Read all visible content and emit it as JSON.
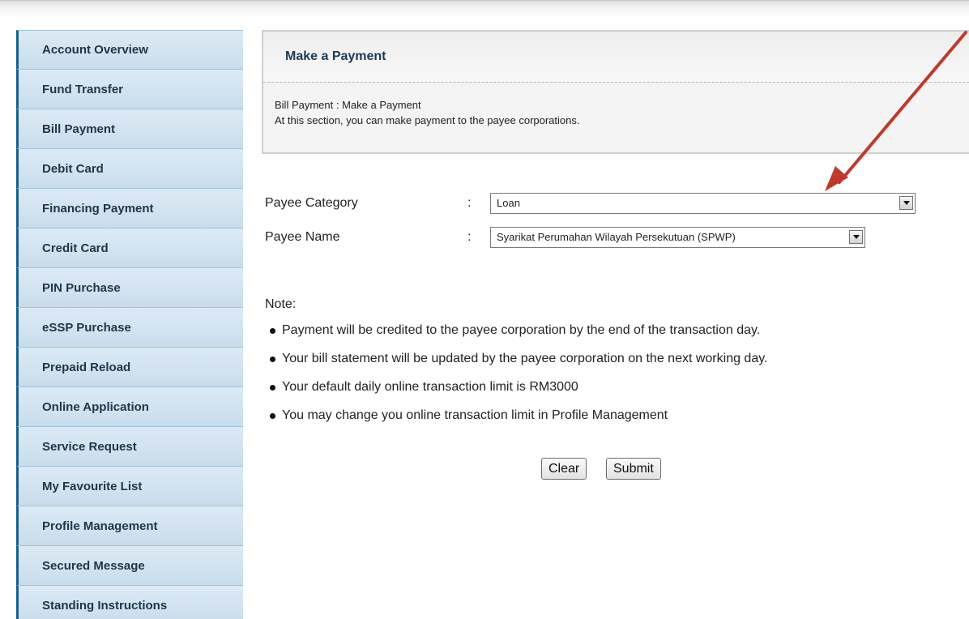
{
  "sidebar": {
    "items": [
      {
        "label": "Account Overview"
      },
      {
        "label": "Fund Transfer"
      },
      {
        "label": "Bill Payment"
      },
      {
        "label": "Debit Card"
      },
      {
        "label": "Financing Payment"
      },
      {
        "label": "Credit Card"
      },
      {
        "label": "PIN Purchase"
      },
      {
        "label": "eSSP Purchase"
      },
      {
        "label": "Prepaid Reload"
      },
      {
        "label": "Online Application"
      },
      {
        "label": "Service Request"
      },
      {
        "label": "My Favourite List"
      },
      {
        "label": "Profile Management"
      },
      {
        "label": "Secured Message"
      },
      {
        "label": "Standing Instructions"
      }
    ]
  },
  "panel": {
    "title": "Make a Payment",
    "breadcrumb": "Bill Payment : Make a Payment",
    "description": "At this section, you can make payment to the payee corporations."
  },
  "form": {
    "payee_category": {
      "label": "Payee Category",
      "colon": ":",
      "value": "Loan"
    },
    "payee_name": {
      "label": "Payee Name",
      "colon": ":",
      "value": "Syarikat Perumahan Wilayah Persekutuan (SPWP)"
    }
  },
  "note": {
    "title": "Note:",
    "items": [
      "Payment will be credited to the payee corporation by the end of the transaction day.",
      "Your bill statement will be updated by the payee corporation on the next working day.",
      "Your default daily online transaction limit is RM3000",
      "You may change you online transaction limit in Profile Management"
    ]
  },
  "buttons": {
    "clear": "Clear",
    "submit": "Submit"
  },
  "colors": {
    "nav_bg": "#c9dcec",
    "nav_accent": "#1a5f8a",
    "annotation_arrow": "#c0392b"
  }
}
